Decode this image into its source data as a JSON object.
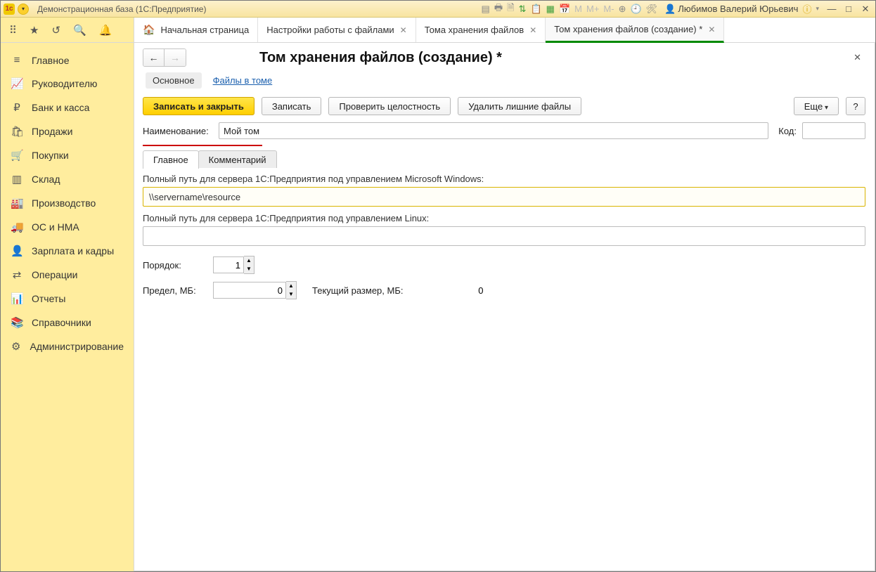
{
  "titlebar": {
    "title": "Демонстрационная база  (1С:Предприятие)",
    "user_name": "Любимов Валерий Юрьевич",
    "m_labels": [
      "M",
      "M+",
      "M-"
    ]
  },
  "doctabs": {
    "home": "Начальная страница",
    "t1": "Настройки работы с файлами",
    "t2": "Тома хранения файлов",
    "t3": "Том хранения файлов (создание) *"
  },
  "sidebar": {
    "items": [
      {
        "label": "Главное"
      },
      {
        "label": "Руководителю"
      },
      {
        "label": "Банк и касса"
      },
      {
        "label": "Продажи"
      },
      {
        "label": "Покупки"
      },
      {
        "label": "Склад"
      },
      {
        "label": "Производство"
      },
      {
        "label": "ОС и НМА"
      },
      {
        "label": "Зарплата и кадры"
      },
      {
        "label": "Операции"
      },
      {
        "label": "Отчеты"
      },
      {
        "label": "Справочники"
      },
      {
        "label": "Администрирование"
      }
    ]
  },
  "page": {
    "title": "Том хранения файлов (создание) *",
    "subnav_active": "Основное",
    "subnav_link": "Файлы в томе"
  },
  "toolbar": {
    "save_close": "Записать и закрыть",
    "save": "Записать",
    "check": "Проверить целостность",
    "delete_extra": "Удалить лишние файлы",
    "more": "Еще",
    "help": "?"
  },
  "form": {
    "name_label": "Наименование:",
    "name_value": "Мой том",
    "code_label": "Код:",
    "code_value": ""
  },
  "innertabs": {
    "main": "Главное",
    "comment": "Комментарий"
  },
  "fields": {
    "path_win_label": "Полный путь для сервера 1С:Предприятия под управлением Microsoft Windows:",
    "path_win_value": "\\\\servername\\resource",
    "path_lin_label": "Полный путь для сервера 1С:Предприятия под управлением Linux:",
    "path_lin_value": "",
    "order_label": "Порядок:",
    "order_value": "1",
    "limit_label": "Предел, МБ:",
    "limit_value": "0",
    "cursize_label": "Текущий размер, МБ:",
    "cursize_value": "0"
  }
}
